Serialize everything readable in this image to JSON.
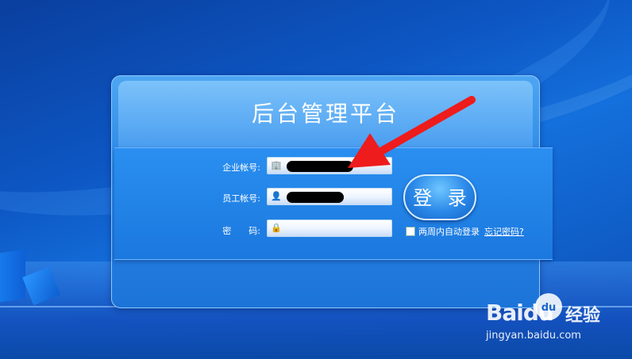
{
  "login": {
    "title": "后台管理平台",
    "company_account_label": "企业帐号:",
    "employee_account_label": "员工帐号:",
    "password_label": "密　　码:",
    "login_button": "登 录",
    "remember_label": "两周内自动登录",
    "forgot_link": "忘记密码?"
  },
  "watermark": {
    "logo": "Baidu",
    "paw": "du",
    "name": "经验",
    "url": "jingyan.baidu.com"
  },
  "colors": {
    "background": "#0d57c4",
    "panel": "#2a86e4",
    "arrow": "#ee1c1c"
  }
}
